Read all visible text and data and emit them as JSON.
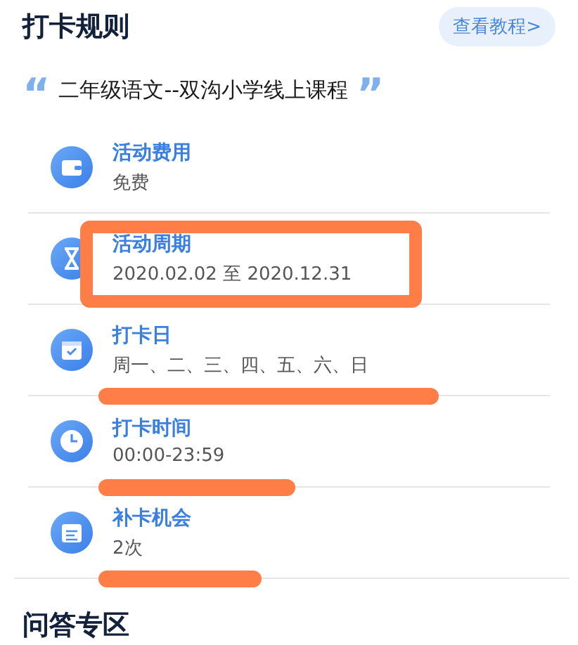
{
  "header": {
    "title": "打卡规则",
    "tutorial_button": "查看教程>"
  },
  "course": {
    "quote_open": "“",
    "name": "二年级语文--双沟小学线上课程",
    "quote_close": "”"
  },
  "rules": [
    {
      "label": "活动费用",
      "value": "免费",
      "boxed": false,
      "underlined": false
    },
    {
      "label": "活动周期",
      "value": "2020.02.02 至 2020.12.31",
      "boxed": true,
      "underlined": false
    },
    {
      "label": "打卡日",
      "value": "周一、二、三、四、五、六、日",
      "boxed": false,
      "underlined": true
    },
    {
      "label": "打卡时间",
      "value": "00:00-23:59",
      "boxed": false,
      "underlined": true
    },
    {
      "label": "补卡机会",
      "value": "2次",
      "boxed": false,
      "underlined": true
    }
  ],
  "next_section": {
    "title": "问答专区"
  }
}
